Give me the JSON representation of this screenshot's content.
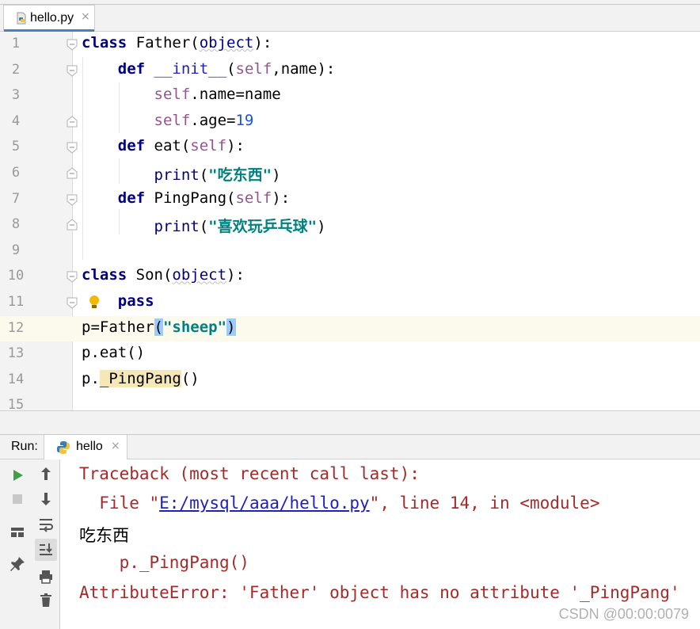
{
  "tab": {
    "file_name": "hello.py",
    "close_glyph": "×"
  },
  "editor": {
    "lines": [
      {
        "n": "1",
        "parts": [
          [
            "kw",
            "class"
          ],
          [
            "t",
            " Father"
          ],
          [
            "t",
            "("
          ],
          [
            "bi",
            "object"
          ],
          [
            "t",
            "):"
          ]
        ]
      },
      {
        "n": "2",
        "parts": [
          [
            "t",
            "    "
          ],
          [
            "kw",
            "def"
          ],
          [
            "t",
            " "
          ],
          [
            "fn",
            "__init__"
          ],
          [
            "t",
            "("
          ],
          [
            "slf",
            "self"
          ],
          [
            "t",
            ",name):"
          ]
        ]
      },
      {
        "n": "3",
        "parts": [
          [
            "t",
            "        "
          ],
          [
            "slf",
            "self"
          ],
          [
            "t",
            ".name=name"
          ]
        ]
      },
      {
        "n": "4",
        "parts": [
          [
            "t",
            "        "
          ],
          [
            "slf",
            "self"
          ],
          [
            "t",
            ".age="
          ],
          [
            "num",
            "19"
          ]
        ]
      },
      {
        "n": "5",
        "parts": [
          [
            "t",
            "    "
          ],
          [
            "kw",
            "def"
          ],
          [
            "t",
            " eat("
          ],
          [
            "slf",
            "self"
          ],
          [
            "t",
            "):"
          ]
        ]
      },
      {
        "n": "6",
        "parts": [
          [
            "t",
            "        "
          ],
          [
            "bi",
            "print"
          ],
          [
            "t",
            "("
          ],
          [
            "str",
            "\"吃东西\""
          ],
          [
            "t",
            ")"
          ]
        ]
      },
      {
        "n": "7",
        "parts": [
          [
            "t",
            "    "
          ],
          [
            "kw",
            "def"
          ],
          [
            "t",
            " PingPang("
          ],
          [
            "slf",
            "self"
          ],
          [
            "t",
            "):"
          ]
        ]
      },
      {
        "n": "8",
        "parts": [
          [
            "t",
            "        "
          ],
          [
            "bi",
            "print"
          ],
          [
            "t",
            "("
          ],
          [
            "str",
            "\"喜欢玩乒乓球\""
          ],
          [
            "t",
            ")"
          ]
        ]
      },
      {
        "n": "9",
        "parts": []
      },
      {
        "n": "10",
        "parts": [
          [
            "kw",
            "class"
          ],
          [
            "t",
            " Son("
          ],
          [
            "bi",
            "object"
          ],
          [
            "t",
            "):"
          ]
        ]
      },
      {
        "n": "11",
        "parts": [
          [
            "t",
            "    "
          ],
          [
            "kw",
            "pass"
          ]
        ]
      },
      {
        "n": "12",
        "parts": [
          [
            "t",
            "p=Father"
          ],
          [
            "brace",
            "("
          ],
          [
            "str",
            "\"sheep\""
          ],
          [
            "brace",
            ")"
          ]
        ]
      },
      {
        "n": "13",
        "parts": [
          [
            "t",
            "p.eat()"
          ]
        ]
      },
      {
        "n": "14",
        "parts": [
          [
            "t",
            "p."
          ],
          [
            "hl",
            "_PingPang"
          ],
          [
            "t",
            "()"
          ]
        ]
      },
      {
        "n": "15",
        "parts": []
      }
    ]
  },
  "run": {
    "label": "Run:",
    "tab_name": "hello",
    "close_glyph": "×"
  },
  "console": {
    "traceback": "Traceback (most recent call last):",
    "file_prefix": "  File \"",
    "file_link": "E:/mysql/aaa/hello.py",
    "file_suffix": "\", line 14, in <module>",
    "stdout": "吃东西",
    "code_line": "    p._PingPang()",
    "error": "AttributeError: 'Father' object has no attribute '_PingPang'"
  },
  "watermark": "CSDN @00:00:0079",
  "colors": {
    "accent": "#4083c9",
    "keyword": "#000080",
    "string": "#008080",
    "error": "#a52a2a",
    "link": "#2020c0"
  }
}
